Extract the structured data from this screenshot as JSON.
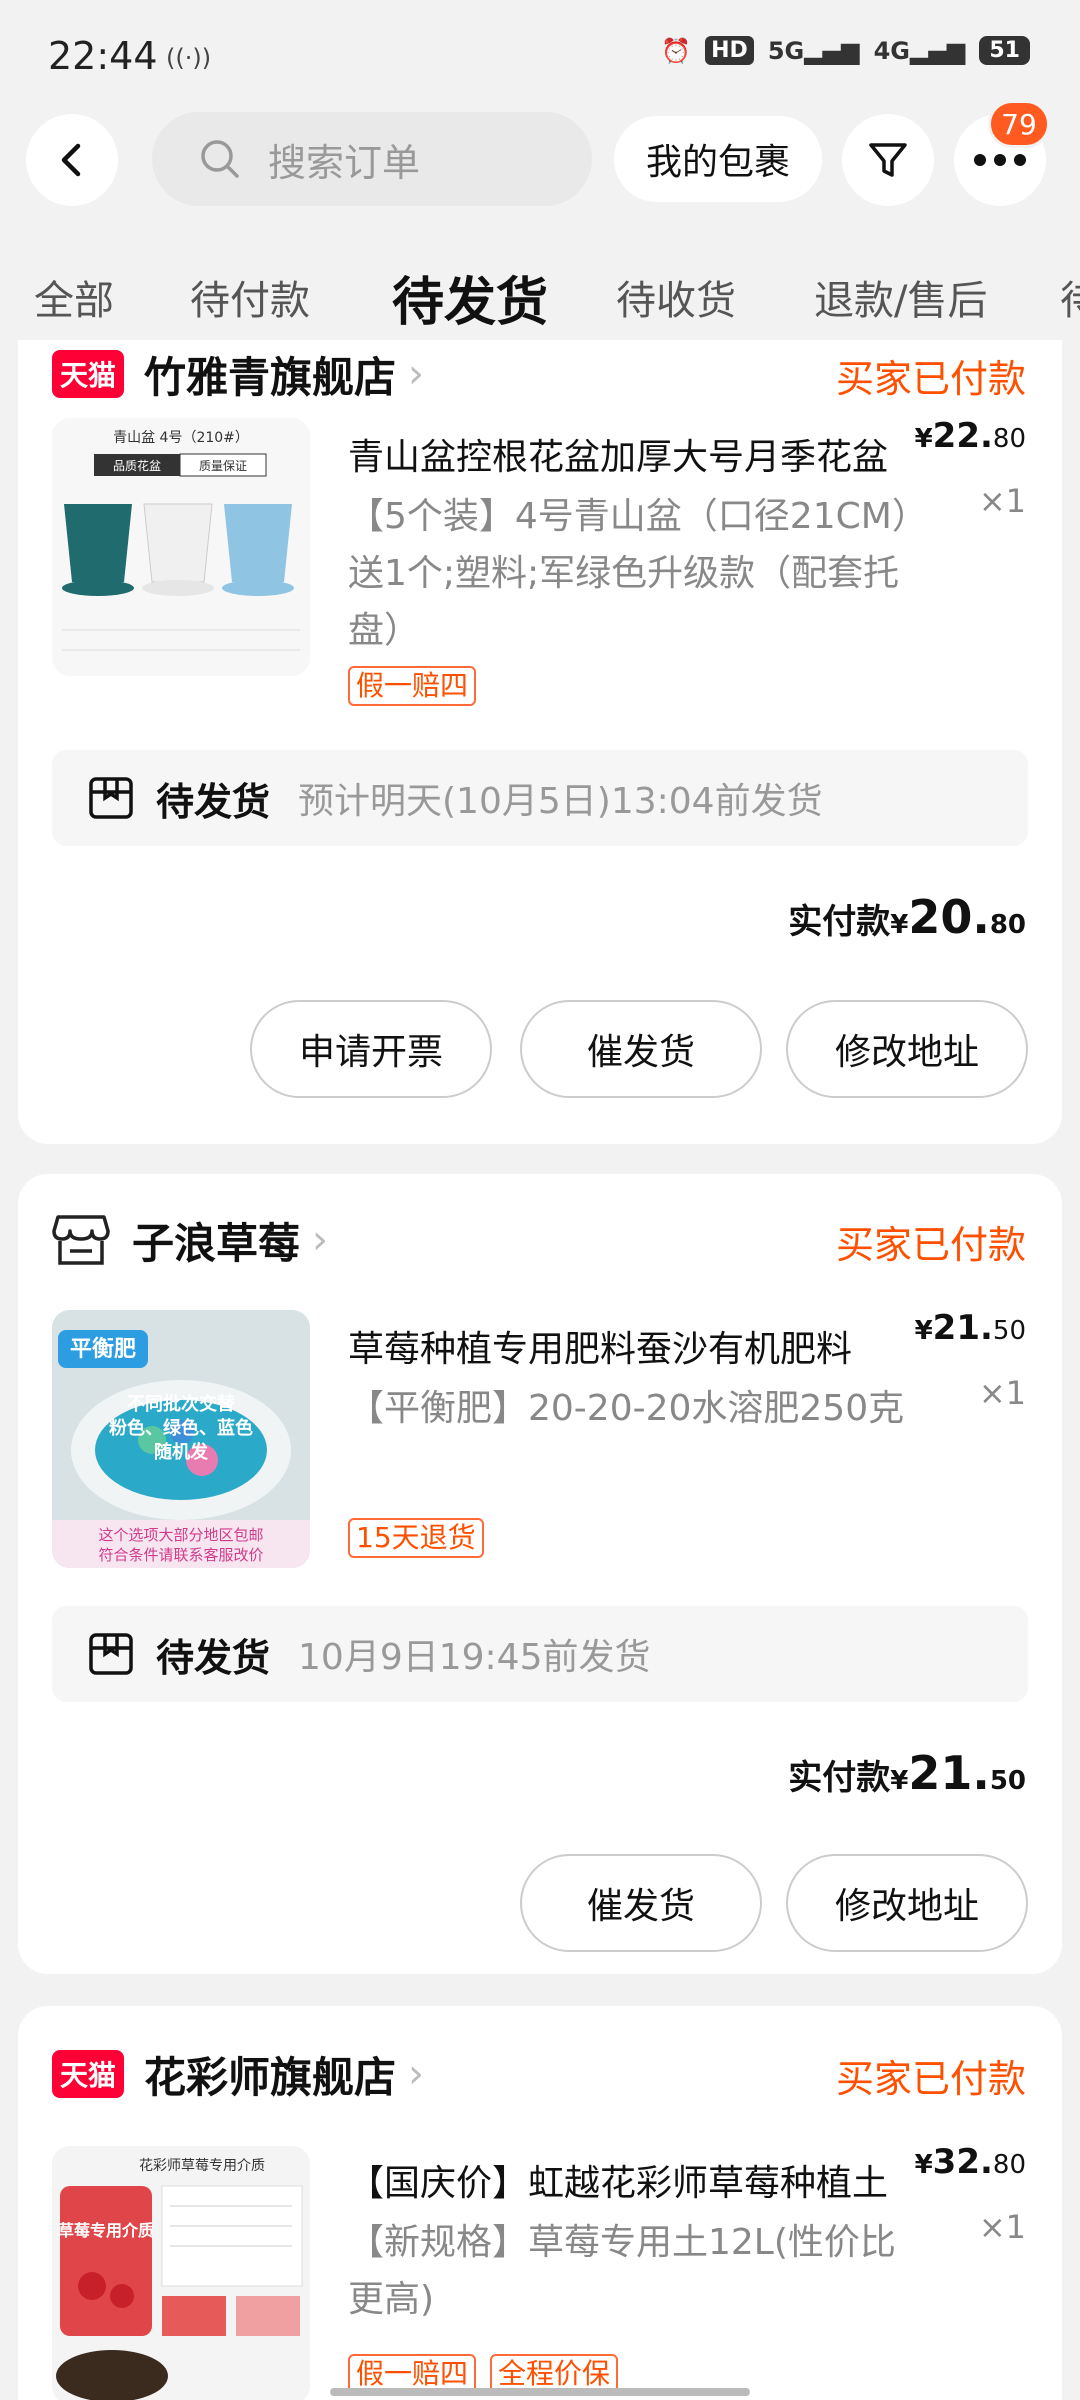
{
  "status_bar": {
    "time": "22:44",
    "sub": "((·))",
    "hd": "HD",
    "net1": "5G",
    "net2": "4G",
    "battery": "51"
  },
  "header": {
    "search_placeholder": "搜索订单",
    "packages_label": "我的包裹",
    "badge_count": "79"
  },
  "tabs": [
    {
      "label": "全部"
    },
    {
      "label": "待付款"
    },
    {
      "label": "待发货"
    },
    {
      "label": "待收货"
    },
    {
      "label": "退款/售后"
    },
    {
      "label": "待"
    }
  ],
  "orders": [
    {
      "shop": "竹雅青旗舰店",
      "tmall": "天猫",
      "status": "买家已付款",
      "title": "青山盆控根花盆加厚大号月季花盆",
      "sku": "【5个装】4号青山盆（口径21CM）送1个;塑料;军绿色升级款（配套托盘）",
      "price_cur": "¥",
      "price_int": "22.",
      "price_dec": "80",
      "qty": "×1",
      "tags": [
        "假一赔四"
      ],
      "ship_label": "待发货",
      "ship_desc": "预计明天(10月5日)13:04前发货",
      "total_label": "实付款",
      "total_cur": "¥",
      "total_int": "20.",
      "total_dec": "80",
      "buttons": [
        "申请开票",
        "催发货",
        "修改地址"
      ],
      "thumb_lines": [
        "青山盆  4号（210#）",
        "品质花盆",
        "质量保证"
      ]
    },
    {
      "shop": "子浪草莓",
      "status": "买家已付款",
      "title": "草莓种植专用肥料蚕沙有机肥料",
      "sku": "【平衡肥】20-20-20水溶肥250克",
      "price_cur": "¥",
      "price_int": "21.",
      "price_dec": "50",
      "qty": "×1",
      "tags": [
        "15天退货"
      ],
      "ship_label": "待发货",
      "ship_desc": "10月9日19:45前发货",
      "total_label": "实付款",
      "total_cur": "¥",
      "total_int": "21.",
      "total_dec": "50",
      "buttons": [
        "催发货",
        "修改地址"
      ],
      "thumb_lines": [
        "平衡肥",
        "不同批次交替",
        "粉色、绿色、蓝色",
        "随机发",
        "这个选项大部分地区包邮",
        "符合条件请联系客服改价"
      ]
    },
    {
      "shop": "花彩师旗舰店",
      "tmall": "天猫",
      "status": "买家已付款",
      "title": "【国庆价】虹越花彩师草莓种植土",
      "sku": "【新规格】草莓专用土12L(性价比更高)",
      "price_cur": "¥",
      "price_int": "32.",
      "price_dec": "80",
      "qty": "×1",
      "tags": [
        "假一赔四",
        "全程价保"
      ],
      "thumb_lines": [
        "花彩师草莓专用介质",
        "草莓专用介质"
      ]
    }
  ],
  "colors": {
    "accent": "#ff5000",
    "tmall": "#ff0036",
    "badge": "#ff5a1f"
  }
}
